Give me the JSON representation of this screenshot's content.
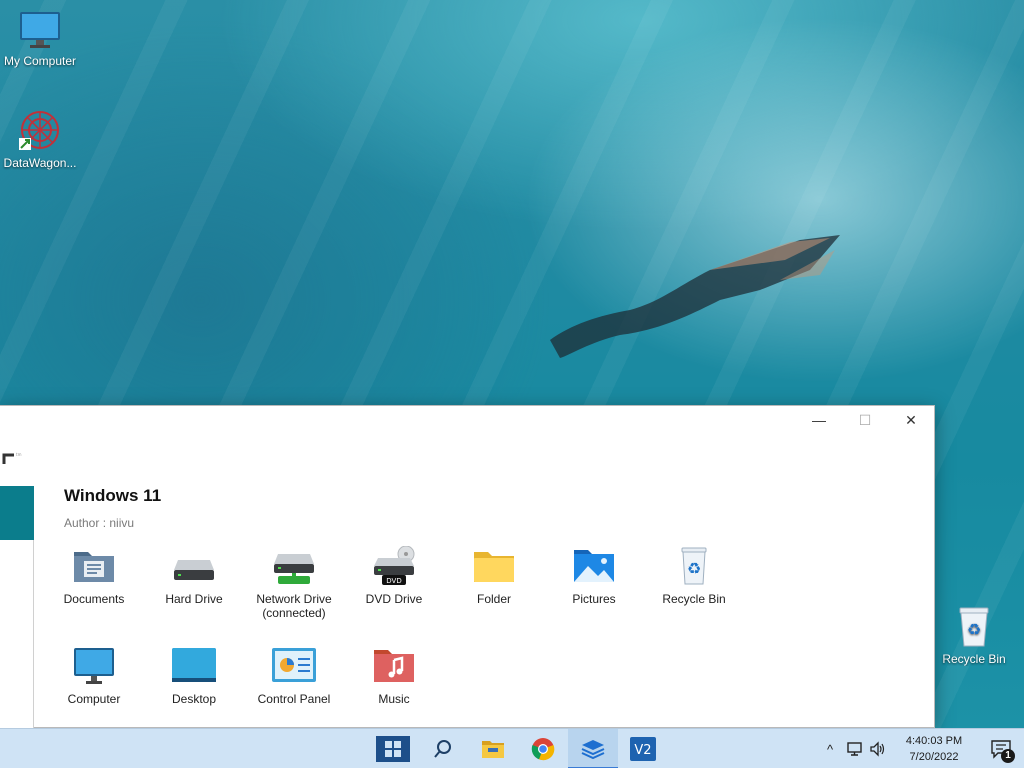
{
  "desktop": {
    "icons": [
      {
        "label": "My Computer",
        "icon": "monitor-icon"
      },
      {
        "label": "DataWagon...",
        "icon": "datawagon-shortcut-icon"
      },
      {
        "label": "Recycle Bin",
        "icon": "recycle-bin-icon"
      }
    ]
  },
  "window": {
    "title": "Windows 11",
    "author": "Author : niivu",
    "controls": {
      "minimize": "—",
      "maximize": "☐",
      "close": "✕"
    },
    "items": [
      {
        "label": "Documents",
        "icon": "documents-drive-icon"
      },
      {
        "label": "Hard Drive",
        "icon": "hard-drive-icon"
      },
      {
        "label": "Network Drive",
        "label2": "(connected)",
        "icon": "network-drive-icon"
      },
      {
        "label": "DVD Drive",
        "icon": "dvd-drive-icon",
        "badge": "DVD"
      },
      {
        "label": "Folder",
        "icon": "folder-icon"
      },
      {
        "label": "Pictures",
        "icon": "pictures-icon"
      },
      {
        "label": "Recycle Bin",
        "icon": "recycle-bin-icon"
      },
      {
        "label": "Computer",
        "icon": "computer-icon"
      },
      {
        "label": "Desktop",
        "icon": "desktop-icon"
      },
      {
        "label": "Control Panel",
        "icon": "control-panel-icon"
      },
      {
        "label": "Music",
        "icon": "music-icon"
      }
    ]
  },
  "taskbar": {
    "apps": [
      "start-icon",
      "search-icon",
      "file-explorer-icon",
      "chrome-icon",
      "layers-app-icon",
      "vs-app-icon"
    ],
    "tray": {
      "time": "4:40:03 PM",
      "date": "7/20/2022",
      "notification_count": "1"
    }
  },
  "colors": {
    "accent": "#0b7d8c",
    "taskbar": "#cfe3f5"
  }
}
